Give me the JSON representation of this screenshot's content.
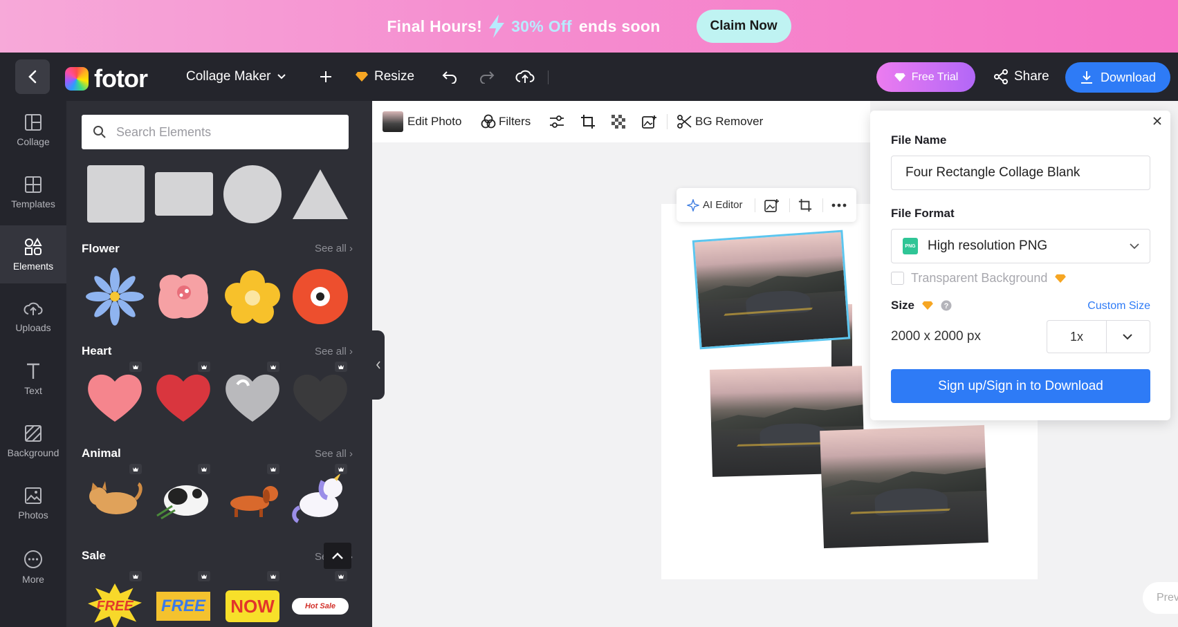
{
  "promo": {
    "text_a": "Final Hours!",
    "text_b": "30% Off",
    "text_c": "ends soon",
    "cta": "Claim Now"
  },
  "topbar": {
    "brand": "fotor",
    "mode": "Collage Maker",
    "resize": "Resize",
    "free_trial": "Free Trial",
    "share": "Share",
    "download": "Download"
  },
  "rail": [
    {
      "label": "Collage",
      "icon": "collage-icon"
    },
    {
      "label": "Templates",
      "icon": "templates-icon"
    },
    {
      "label": "Elements",
      "icon": "elements-icon"
    },
    {
      "label": "Uploads",
      "icon": "upload-cloud-icon"
    },
    {
      "label": "Text",
      "icon": "text-icon"
    },
    {
      "label": "Background",
      "icon": "background-icon"
    },
    {
      "label": "Photos",
      "icon": "photos-icon"
    },
    {
      "label": "More",
      "icon": "more-icon"
    }
  ],
  "panel": {
    "search_placeholder": "Search Elements",
    "sections": [
      {
        "title": "Flower",
        "see_all": "See all"
      },
      {
        "title": "Heart",
        "see_all": "See all"
      },
      {
        "title": "Animal",
        "see_all": "See all"
      },
      {
        "title": "Sale",
        "see_all": "See all"
      }
    ],
    "sale_stickers": [
      "FREE",
      "FREE",
      "NOW",
      "Hot Sale"
    ]
  },
  "edit_toolbar": {
    "edit_photo": "Edit Photo",
    "filters": "Filters",
    "bg_remover": "BG Remover"
  },
  "canvas_toolbar": {
    "ai_editor": "AI Editor"
  },
  "download_popup": {
    "file_name_label": "File Name",
    "file_name_value": "Four Rectangle Collage Blank",
    "file_format_label": "File Format",
    "format_value": "High resolution PNG",
    "format_badge": "PNG",
    "transparent_label": "Transparent Background",
    "size_label": "Size",
    "custom_size": "Custom Size",
    "size_value": "2000 x 2000 px",
    "scale": "1x",
    "signup": "Sign up/Sign in to Download"
  },
  "prev": "Prev",
  "colors": {
    "accent": "#2e7bf6",
    "dark": "#24252c",
    "panel": "#2e2f36",
    "promo": "#f674c6"
  }
}
